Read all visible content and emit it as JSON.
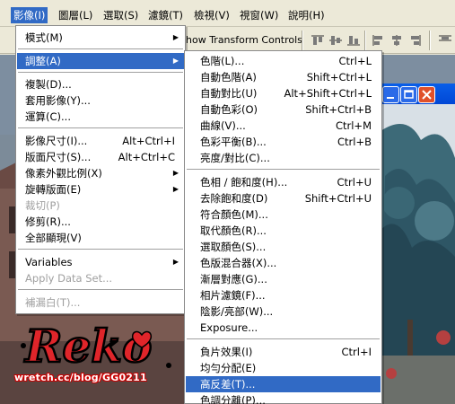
{
  "menubar": {
    "items": [
      "影像(I)",
      "圖層(L)",
      "選取(S)",
      "濾鏡(T)",
      "檢視(V)",
      "視窗(W)",
      "說明(H)"
    ]
  },
  "toolbar": {
    "show_transform_controls": "how Transform Controls"
  },
  "image_menu": {
    "items": [
      {
        "label": "模式(M)",
        "shortcut": "",
        "submenu": true,
        "disabled": false
      },
      {
        "label": "調整(A)",
        "shortcut": "",
        "submenu": true,
        "disabled": false,
        "highlighted": true
      },
      {
        "label": "複製(D)...",
        "shortcut": "",
        "submenu": false,
        "disabled": false
      },
      {
        "label": "套用影像(Y)...",
        "shortcut": "",
        "submenu": false,
        "disabled": false
      },
      {
        "label": "運算(C)...",
        "shortcut": "",
        "submenu": false,
        "disabled": false
      },
      {
        "label": "影像尺寸(I)...",
        "shortcut": "Alt+Ctrl+I",
        "submenu": false,
        "disabled": false
      },
      {
        "label": "版面尺寸(S)...",
        "shortcut": "Alt+Ctrl+C",
        "submenu": false,
        "disabled": false
      },
      {
        "label": "像素外觀比例(X)",
        "shortcut": "",
        "submenu": true,
        "disabled": false
      },
      {
        "label": "旋轉版面(E)",
        "shortcut": "",
        "submenu": true,
        "disabled": false
      },
      {
        "label": "裁切(P)",
        "shortcut": "",
        "submenu": false,
        "disabled": true
      },
      {
        "label": "修剪(R)...",
        "shortcut": "",
        "submenu": false,
        "disabled": false
      },
      {
        "label": "全部顯現(V)",
        "shortcut": "",
        "submenu": false,
        "disabled": false
      },
      {
        "label": "Variables",
        "shortcut": "",
        "submenu": true,
        "disabled": false
      },
      {
        "label": "Apply Data Set...",
        "shortcut": "",
        "submenu": false,
        "disabled": true
      },
      {
        "label": "補漏白(T)...",
        "shortcut": "",
        "submenu": false,
        "disabled": true
      }
    ]
  },
  "adjust_menu": {
    "items": [
      {
        "label": "色階(L)...",
        "shortcut": "Ctrl+L"
      },
      {
        "label": "自動色階(A)",
        "shortcut": "Shift+Ctrl+L"
      },
      {
        "label": "自動對比(U)",
        "shortcut": "Alt+Shift+Ctrl+L"
      },
      {
        "label": "自動色彩(O)",
        "shortcut": "Shift+Ctrl+B"
      },
      {
        "label": "曲線(V)...",
        "shortcut": "Ctrl+M"
      },
      {
        "label": "色彩平衡(B)...",
        "shortcut": "Ctrl+B"
      },
      {
        "label": "亮度/對比(C)...",
        "shortcut": ""
      },
      {
        "label": "色相 / 飽和度(H)...",
        "shortcut": "Ctrl+U"
      },
      {
        "label": "去除飽和度(D)",
        "shortcut": "Shift+Ctrl+U"
      },
      {
        "label": "符合顏色(M)...",
        "shortcut": ""
      },
      {
        "label": "取代顏色(R)...",
        "shortcut": ""
      },
      {
        "label": "選取顏色(S)...",
        "shortcut": ""
      },
      {
        "label": "色版混合器(X)...",
        "shortcut": ""
      },
      {
        "label": "漸層對應(G)...",
        "shortcut": ""
      },
      {
        "label": "相片濾鏡(F)...",
        "shortcut": ""
      },
      {
        "label": "陰影/亮部(W)...",
        "shortcut": ""
      },
      {
        "label": "Exposure...",
        "shortcut": ""
      },
      {
        "label": "負片效果(I)",
        "shortcut": "Ctrl+I"
      },
      {
        "label": "均勻分配(E)",
        "shortcut": ""
      },
      {
        "label": "高反差(T)...",
        "shortcut": "",
        "highlighted": true
      },
      {
        "label": "色調分離(P)...",
        "shortcut": ""
      }
    ]
  },
  "watermark": {
    "url": "wretch.cc/blog/GG0211"
  }
}
